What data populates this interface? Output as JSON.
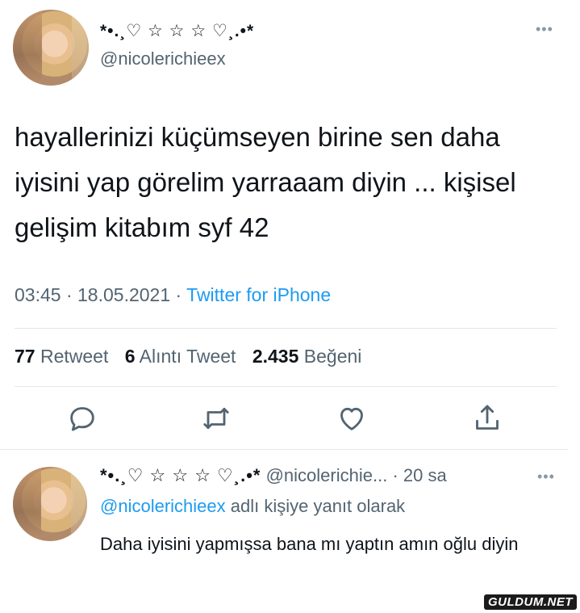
{
  "tweet": {
    "author": {
      "display_name": "*•.¸♡ ☆ ☆ ☆ ♡¸.•*",
      "handle": "@nicolerichieex"
    },
    "more_icon": "more-horizontal-icon",
    "text": "hayallerinizi küçümseyen birine sen daha iyisini yap görelim yarraaam diyin ... kişisel gelişim kitabım syf 42",
    "time": "03:45",
    "date": "18.05.2021",
    "source": "Twitter for iPhone",
    "stats": {
      "retweets_count": "77",
      "retweets_label": "Retweet",
      "quotes_count": "6",
      "quotes_label": "Alıntı Tweet",
      "likes_count": "2.435",
      "likes_label": "Beğeni"
    },
    "actions": [
      "reply-icon",
      "retweet-icon",
      "like-icon",
      "share-icon"
    ]
  },
  "reply": {
    "display_name": "*•.¸♡ ☆ ☆ ☆ ♡¸.•*",
    "handle": "@nicolerichie...",
    "time": "20 sa",
    "reply_to_handle": "@nicolerichieex",
    "reply_to_suffix": "adlı kişiye yanıt olarak",
    "text": "Daha iyisini yapmışsa bana mı yaptın amın oğlu diyin"
  },
  "watermark": "GULDUM.NET",
  "colors": {
    "link": "#1d9bf0",
    "secondary_text": "#536471",
    "primary_text": "#0f1419",
    "divider": "#e3e7ea"
  }
}
